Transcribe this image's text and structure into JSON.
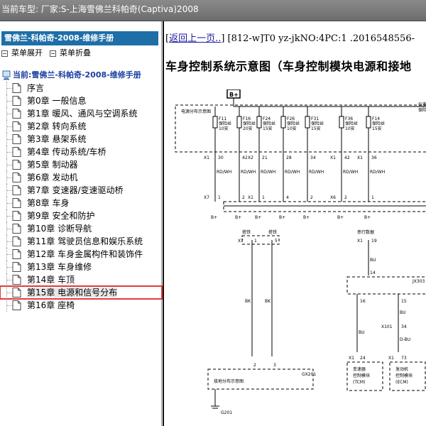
{
  "titlebar": {
    "text": "当前车型:  厂家:S-上海雪佛兰科帕奇(Captiva)2008"
  },
  "sidebar": {
    "header": "雪佛兰-科帕奇-2008-维修手册",
    "expand_label": "菜单展开",
    "collapse_label": "菜单折叠",
    "root_label": "当前:雪佛兰-科帕奇-2008-维修手册",
    "items": [
      {
        "label": "序言"
      },
      {
        "label": "第0章 一般信息"
      },
      {
        "label": "第1章 暖风、通风与空调系统"
      },
      {
        "label": "第2章 转向系统"
      },
      {
        "label": "第3章 悬架系统"
      },
      {
        "label": "第4章 传动系统/车桥"
      },
      {
        "label": "第5章 制动器"
      },
      {
        "label": "第6章 发动机"
      },
      {
        "label": "第7章 变速器/变速驱动桥"
      },
      {
        "label": "第8章 车身"
      },
      {
        "label": "第9章 安全和防护"
      },
      {
        "label": "第10章 诊断导航"
      },
      {
        "label": "第11章 驾驶员信息和娱乐系统"
      },
      {
        "label": "第12章 车身金属构件和装饰件"
      },
      {
        "label": "第13章 车身维修"
      },
      {
        "label": "第14章 车顶"
      },
      {
        "label": "第15章 电源和信号分布",
        "selected": true
      },
      {
        "label": "第16章 座椅"
      }
    ]
  },
  "content": {
    "nav_prefix": "[",
    "back_link": "返回上一页..",
    "nav_info": "] [812-w]T0 yz-jkNO:4PC:1 .2016548556-",
    "title": "车身控制系统示意图（车身控制模块电源和接地",
    "diagram": {
      "bplus_top": "B+",
      "fuse_box_label": "电源分布示意图",
      "right_label_1": "仪表板",
      "right_label_2": "保险丝盒",
      "fuses": [
        {
          "name": "F11",
          "t1": "保险丝",
          "t2": "10安",
          "top": "X1",
          "topnum": "30",
          "bot": "X7",
          "botnum": "1"
        },
        {
          "name": "F16",
          "t1": "保险丝",
          "t2": "20安",
          "top": "",
          "topnum": "42",
          "bot": "",
          "botnum": "2"
        },
        {
          "name": "F24",
          "t1": "保险丝",
          "t2": "15安",
          "top": "X2",
          "topnum": "21",
          "bot": "X1",
          "botnum": "1"
        },
        {
          "name": "F26",
          "t1": "保险丝",
          "t2": "10安",
          "top": "",
          "topnum": "28",
          "bot": "",
          "botnum": "4"
        },
        {
          "name": "F31",
          "t1": "保险丝",
          "t2": "15安",
          "top": "",
          "topnum": "34",
          "bot": "",
          "botnum": "2"
        },
        {
          "name": "F36",
          "t1": "保险丝",
          "t2": "10安",
          "top": "X1",
          "topnum": "42",
          "bot": "X6",
          "botnum": "2"
        },
        {
          "name": "F14",
          "t1": "保险丝",
          "t2": "15安",
          "top": "X1",
          "topnum": "36",
          "bot": "",
          "botnum": "1"
        }
      ],
      "wire_color": "RD/WH",
      "bplus_label": "B+",
      "ground_label_1": "搭铁",
      "ground_label_2": "搭铁",
      "serial_label": "串行数据",
      "x7_label": "X7",
      "pin1": "1",
      "pin5": "5",
      "x1_label": "X1",
      "pin19": "19",
      "bu_label": "BU",
      "pin14": "14",
      "jx_label": "JX303",
      "pin16": "16",
      "pin15": "15",
      "bk_label": "BK",
      "bu_label_2": "BU",
      "x101_label": "X101",
      "pin34": "34",
      "dbu_label": "D-BU",
      "x1b": "X1",
      "pin24": "24",
      "x1c": "X1",
      "pin73": "73",
      "pin2": "2",
      "pin3": "3",
      "gx201": "GX201",
      "ground_dist_label": "接地分布示意图",
      "tcm_line1": "变速器",
      "tcm_line2": "控制模块",
      "tcm_line3": "(TCM)",
      "ecm_line1": "发动机",
      "ecm_line2": "控制模块",
      "ecm_line3": "(ECM)",
      "g201": "G201"
    }
  }
}
